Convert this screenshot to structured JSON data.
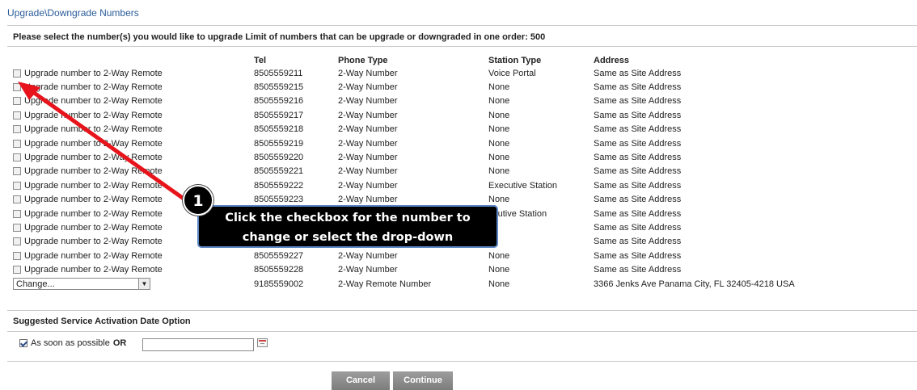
{
  "page": {
    "title": "Upgrade\\Downgrade Numbers",
    "instructions": "Please select the number(s) you would like to upgrade Limit of numbers that can be upgrade or downgraded in one order: 500"
  },
  "table": {
    "headers": [
      "",
      "Tel",
      "Phone Type",
      "Station Type",
      "Address"
    ],
    "rows": [
      {
        "action": "Upgrade number to 2-Way Remote",
        "tel": "8505559211",
        "phone_type": "2-Way Number",
        "station_type": "Voice Portal",
        "address": "Same as Site Address"
      },
      {
        "action": "Upgrade number to 2-Way Remote",
        "tel": "8505559215",
        "phone_type": "2-Way Number",
        "station_type": "None",
        "address": "Same as Site Address"
      },
      {
        "action": "Upgrade number to 2-Way Remote",
        "tel": "8505559216",
        "phone_type": "2-Way Number",
        "station_type": "None",
        "address": "Same as Site Address"
      },
      {
        "action": "Upgrade number to 2-Way Remote",
        "tel": "8505559217",
        "phone_type": "2-Way Number",
        "station_type": "None",
        "address": "Same as Site Address"
      },
      {
        "action": "Upgrade number to 2-Way Remote",
        "tel": "8505559218",
        "phone_type": "2-Way Number",
        "station_type": "None",
        "address": "Same as Site Address"
      },
      {
        "action": "Upgrade number to 2-Way Remote",
        "tel": "8505559219",
        "phone_type": "2-Way Number",
        "station_type": "None",
        "address": "Same as Site Address"
      },
      {
        "action": "Upgrade number to 2-Way Remote",
        "tel": "8505559220",
        "phone_type": "2-Way Number",
        "station_type": "None",
        "address": "Same as Site Address"
      },
      {
        "action": "Upgrade number to 2-Way Remote",
        "tel": "8505559221",
        "phone_type": "2-Way Number",
        "station_type": "None",
        "address": "Same as Site Address"
      },
      {
        "action": "Upgrade number to 2-Way Remote",
        "tel": "8505559222",
        "phone_type": "2-Way Number",
        "station_type": "Executive Station",
        "address": "Same as Site Address"
      },
      {
        "action": "Upgrade number to 2-Way Remote",
        "tel": "8505559223",
        "phone_type": "2-Way Number",
        "station_type": "None",
        "address": "Same as Site Address"
      },
      {
        "action": "Upgrade number to 2-Way Remote",
        "tel": "",
        "phone_type": "",
        "station_type": "ecutive Station",
        "address": "Same as Site Address"
      },
      {
        "action": "Upgrade number to 2-Way Remote",
        "tel": "",
        "phone_type": "",
        "station_type": "ne",
        "address": "Same as Site Address"
      },
      {
        "action": "Upgrade number to 2-Way Remote",
        "tel": "",
        "phone_type": "",
        "station_type": "ne",
        "address": "Same as Site Address"
      },
      {
        "action": "Upgrade number to 2-Way Remote",
        "tel": "8505559227",
        "phone_type": "2-Way Number",
        "station_type": "None",
        "address": "Same as Site Address"
      },
      {
        "action": "Upgrade number to 2-Way Remote",
        "tel": "8505559228",
        "phone_type": "2-Way Number",
        "station_type": "None",
        "address": "Same as Site Address"
      }
    ],
    "remote_row": {
      "select_value": "Change...",
      "tel": "9185559002",
      "phone_type": "2-Way Remote Number",
      "station_type": "None",
      "address": "3366 Jenks Ave Panama City, FL 32405-4218 USA"
    }
  },
  "activation": {
    "section_title": "Suggested Service Activation Date Option",
    "asap_label": "As soon as possible",
    "or_label": "OR",
    "date_value": ""
  },
  "buttons": {
    "cancel": "Cancel",
    "continue": "Continue"
  },
  "callout": {
    "step": "1",
    "line1": "Click the checkbox for the number to",
    "line2": "change or select the drop-down"
  },
  "colors": {
    "title_link": "#2a5c9a",
    "arrow": "#e8141c",
    "callout_border": "#5b86c5",
    "button_gray": "#8c8c8c"
  }
}
